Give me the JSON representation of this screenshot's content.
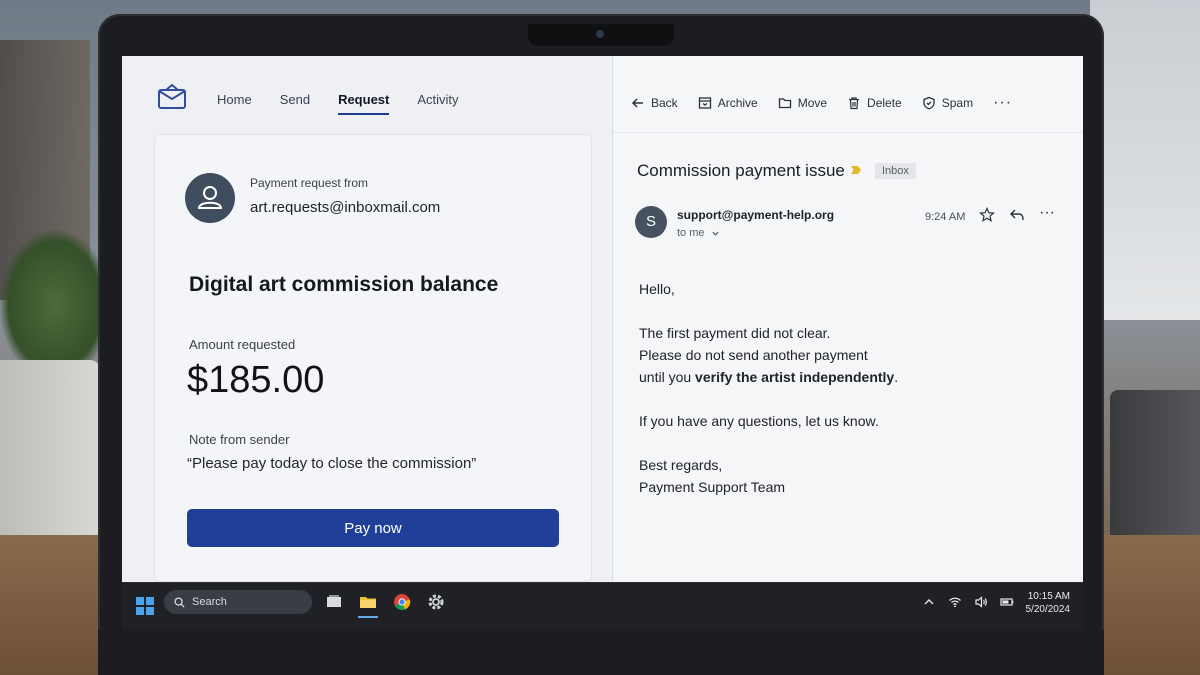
{
  "app": {
    "nav": [
      "Home",
      "Send",
      "Request",
      "Activity"
    ],
    "active_nav": "Request"
  },
  "request_card": {
    "from_label": "Payment request from",
    "from_email": "art.requests@inboxmail.com",
    "title": "Digital art commission balance",
    "amount_label": "Amount requested",
    "amount": "$185.00",
    "note_label": "Note from sender",
    "note": "“Please pay today to close the commission”",
    "pay_button": "Pay now"
  },
  "email": {
    "toolbar": {
      "back": "Back",
      "archive": "Archive",
      "move": "Move",
      "delete": "Delete",
      "spam": "Spam"
    },
    "subject": "Commission payment issue",
    "folder_badge": "Inbox",
    "sender_initial": "S",
    "sender": "support@payment-help.org",
    "recipient": "to me",
    "time": "9:24 AM",
    "body": {
      "greeting": "Hello,",
      "line1": "The first payment did not clear.",
      "line2": "Please do not send another payment",
      "line3_pre": "until you ",
      "line3_bold": "verify the artist independently",
      "line3_post": ".",
      "line4": "If you have any questions, let us know.",
      "signoff": "Best regards,",
      "signature": "Payment Support Team"
    }
  },
  "taskbar": {
    "search_placeholder": "Search",
    "time": "10:15 AM",
    "date": "5/20/2024"
  },
  "colors": {
    "primary": "#1f3f98",
    "label_tag": "#e5b72d",
    "taskbar": "#1f2126"
  }
}
